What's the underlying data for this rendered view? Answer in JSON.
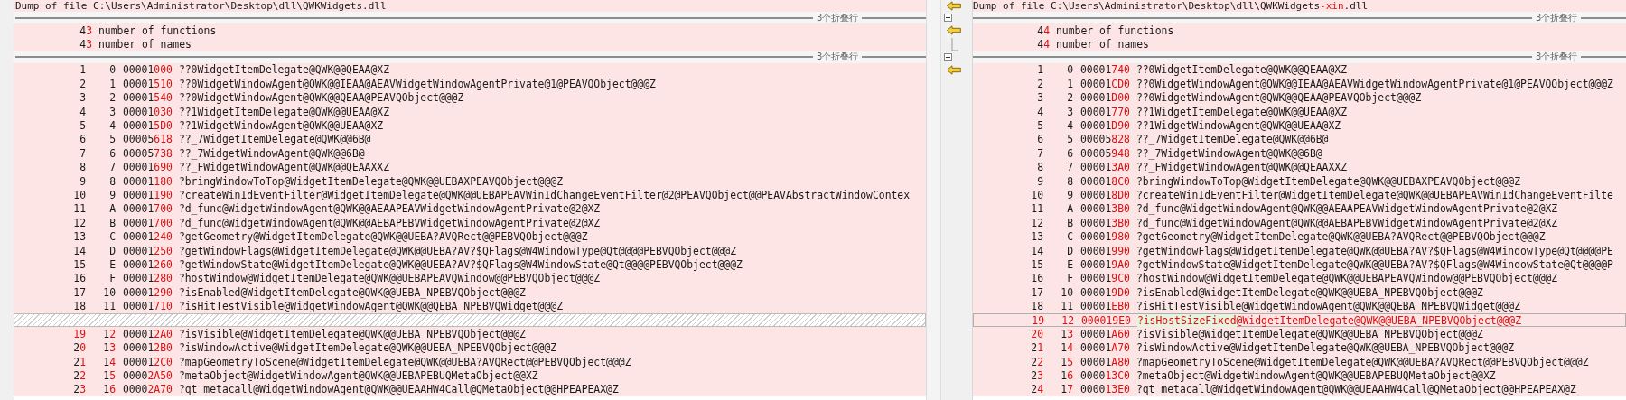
{
  "left_pane": {
    "lines": [
      {
        "kind": "header",
        "text": [
          {
            "text": "Dump of file C:\\Users\\Administrator\\Desktop\\dll\\QWKWidgets.dll"
          }
        ]
      },
      {
        "kind": "fold",
        "label": "3个折叠行"
      },
      {
        "kind": "summary",
        "count": [
          {
            "text": "4"
          },
          {
            "text": "3",
            "changed": true
          }
        ],
        "label": "number of functions"
      },
      {
        "kind": "summary",
        "count": [
          {
            "text": "4"
          },
          {
            "text": "3",
            "changed": true
          }
        ],
        "label": "number of names"
      },
      {
        "kind": "fold",
        "label": "3个折叠行"
      },
      {
        "kind": "export",
        "line": [
          {
            "text": "1"
          }
        ],
        "ordinal": [
          {
            "text": "0"
          }
        ],
        "rva": [
          {
            "text": "00001"
          },
          {
            "text": "000",
            "changed": true
          }
        ],
        "name": [
          {
            "text": "??0WidgetItemDelegate@QWK@@QEAA@XZ"
          }
        ]
      },
      {
        "kind": "export",
        "line": [
          {
            "text": "2"
          }
        ],
        "ordinal": [
          {
            "text": "1"
          }
        ],
        "rva": [
          {
            "text": "00001"
          },
          {
            "text": "510",
            "changed": true
          }
        ],
        "name": [
          {
            "text": "??0WidgetWindowAgent@QWK@@IEAA@AEAVWidgetWindowAgentPrivate@1@PEAVQObject@@@Z"
          }
        ]
      },
      {
        "kind": "export",
        "line": [
          {
            "text": "3"
          }
        ],
        "ordinal": [
          {
            "text": "2"
          }
        ],
        "rva": [
          {
            "text": "00001"
          },
          {
            "text": "540",
            "changed": true
          }
        ],
        "name": [
          {
            "text": "??0WidgetWindowAgent@QWK@@QEAA@PEAVQObject@@@Z"
          }
        ]
      },
      {
        "kind": "export",
        "line": [
          {
            "text": "4"
          }
        ],
        "ordinal": [
          {
            "text": "3"
          }
        ],
        "rva": [
          {
            "text": "00001"
          },
          {
            "text": "030",
            "changed": true
          }
        ],
        "name": [
          {
            "text": "??1WidgetItemDelegate@QWK@@UEAA@XZ"
          }
        ]
      },
      {
        "kind": "export",
        "line": [
          {
            "text": "5"
          }
        ],
        "ordinal": [
          {
            "text": "4"
          }
        ],
        "rva": [
          {
            "text": "00001"
          },
          {
            "text": "5D0",
            "changed": true
          }
        ],
        "name": [
          {
            "text": "??1WidgetWindowAgent@QWK@@UEAA@XZ"
          }
        ]
      },
      {
        "kind": "export",
        "line": [
          {
            "text": "6"
          }
        ],
        "ordinal": [
          {
            "text": "5"
          }
        ],
        "rva": [
          {
            "text": "00005"
          },
          {
            "text": "618",
            "changed": true
          }
        ],
        "name": [
          {
            "text": "??_7WidgetItemDelegate@QWK@@6B@"
          }
        ]
      },
      {
        "kind": "export",
        "line": [
          {
            "text": "7"
          }
        ],
        "ordinal": [
          {
            "text": "6"
          }
        ],
        "rva": [
          {
            "text": "00005"
          },
          {
            "text": "738",
            "changed": true
          }
        ],
        "name": [
          {
            "text": "??_7WidgetWindowAgent@QWK@@6B@"
          }
        ]
      },
      {
        "kind": "export",
        "line": [
          {
            "text": "8"
          }
        ],
        "ordinal": [
          {
            "text": "7"
          }
        ],
        "rva": [
          {
            "text": "00001"
          },
          {
            "text": "690",
            "changed": true
          }
        ],
        "name": [
          {
            "text": "??_FWidgetWindowAgent@QWK@@QEAAXXZ"
          }
        ]
      },
      {
        "kind": "export",
        "line": [
          {
            "text": "9"
          }
        ],
        "ordinal": [
          {
            "text": "8"
          }
        ],
        "rva": [
          {
            "text": "00001"
          },
          {
            "text": "180",
            "changed": true
          }
        ],
        "name": [
          {
            "text": "?bringWindowToTop@WidgetItemDelegate@QWK@@UEBAXPEAVQObject@@@Z"
          }
        ]
      },
      {
        "kind": "export",
        "line": [
          {
            "text": "10"
          }
        ],
        "ordinal": [
          {
            "text": "9"
          }
        ],
        "rva": [
          {
            "text": "00001"
          },
          {
            "text": "190",
            "changed": true
          }
        ],
        "name": [
          {
            "text": "?createWinIdEventFilter@WidgetItemDelegate@QWK@@UEBAPEAVWinIdChangeEventFilter@2@PEAVQObject@@PEAVAbstractWindowContex"
          }
        ]
      },
      {
        "kind": "export",
        "line": [
          {
            "text": "11"
          }
        ],
        "ordinal": [
          {
            "text": "A"
          }
        ],
        "rva": [
          {
            "text": "00001"
          },
          {
            "text": "700",
            "changed": true
          }
        ],
        "name": [
          {
            "text": "?d_func@WidgetWindowAgent@QWK@@AEAAPEAVWidgetWindowAgentPrivate@2@XZ"
          }
        ]
      },
      {
        "kind": "export",
        "line": [
          {
            "text": "12"
          }
        ],
        "ordinal": [
          {
            "text": "B"
          }
        ],
        "rva": [
          {
            "text": "00001"
          },
          {
            "text": "700",
            "changed": true
          }
        ],
        "name": [
          {
            "text": "?d_func@WidgetWindowAgent@QWK@@AEBAPEBVWidgetWindowAgentPrivate@2@XZ"
          }
        ]
      },
      {
        "kind": "export",
        "line": [
          {
            "text": "13"
          }
        ],
        "ordinal": [
          {
            "text": "C"
          }
        ],
        "rva": [
          {
            "text": "00001"
          },
          {
            "text": "240",
            "changed": true
          }
        ],
        "name": [
          {
            "text": "?getGeometry@WidgetItemDelegate@QWK@@UEBA?AVQRect@@PEBVQObject@@@Z"
          }
        ]
      },
      {
        "kind": "export",
        "line": [
          {
            "text": "14"
          }
        ],
        "ordinal": [
          {
            "text": "D"
          }
        ],
        "rva": [
          {
            "text": "00001"
          },
          {
            "text": "250",
            "changed": true
          }
        ],
        "name": [
          {
            "text": "?getWindowFlags@WidgetItemDelegate@QWK@@UEBA?AV?$QFlags@W4WindowType@Qt@@@@PEBVQObject@@@Z"
          }
        ]
      },
      {
        "kind": "export",
        "line": [
          {
            "text": "15"
          }
        ],
        "ordinal": [
          {
            "text": "E"
          }
        ],
        "rva": [
          {
            "text": "00001"
          },
          {
            "text": "260",
            "changed": true
          }
        ],
        "name": [
          {
            "text": "?getWindowState@WidgetItemDelegate@QWK@@UEBA?AV?$QFlags@W4WindowState@Qt@@@@PEBVQObject@@@Z"
          }
        ]
      },
      {
        "kind": "export",
        "line": [
          {
            "text": "16"
          }
        ],
        "ordinal": [
          {
            "text": "F"
          }
        ],
        "rva": [
          {
            "text": "00001"
          },
          {
            "text": "280",
            "changed": true
          }
        ],
        "name": [
          {
            "text": "?hostWindow@WidgetItemDelegate@QWK@@UEBAPEAVQWindow@@PEBVQObject@@@Z"
          }
        ]
      },
      {
        "kind": "export",
        "line": [
          {
            "text": "17"
          }
        ],
        "ordinal": [
          {
            "text": "10"
          }
        ],
        "rva": [
          {
            "text": "00001"
          },
          {
            "text": "290",
            "changed": true
          }
        ],
        "name": [
          {
            "text": "?isEnabled@WidgetItemDelegate@QWK@@UEBA_NPEBVQObject@@@Z"
          }
        ]
      },
      {
        "kind": "export",
        "line": [
          {
            "text": "18"
          }
        ],
        "ordinal": [
          {
            "text": "11"
          }
        ],
        "rva": [
          {
            "text": "00001"
          },
          {
            "text": "710",
            "changed": true
          }
        ],
        "name": [
          {
            "text": "?isHitTestVisible@WidgetWindowAgent@QWK@@QEBA_NPEBVQWidget@@@Z"
          }
        ]
      },
      {
        "kind": "gap"
      },
      {
        "kind": "export",
        "line": [
          {
            "text": "19",
            "changed": true
          }
        ],
        "ordinal": [
          {
            "text": "1"
          },
          {
            "text": "2",
            "changed": true
          }
        ],
        "rva": [
          {
            "text": "00001"
          },
          {
            "text": "2A0",
            "changed": true
          }
        ],
        "name": [
          {
            "text": "?isVisible@WidgetItemDelegate@QWK@@UEBA_NPEBVQObject@@@Z"
          }
        ]
      },
      {
        "kind": "export",
        "line": [
          {
            "text": "2"
          },
          {
            "text": "0",
            "changed": true
          }
        ],
        "ordinal": [
          {
            "text": "1"
          },
          {
            "text": "3",
            "changed": true
          }
        ],
        "rva": [
          {
            "text": "00001"
          },
          {
            "text": "2B0",
            "changed": true
          }
        ],
        "name": [
          {
            "text": "?isWindowActive@WidgetItemDelegate@QWK@@UEBA_NPEBVQObject@@@Z"
          }
        ]
      },
      {
        "kind": "export",
        "line": [
          {
            "text": "2"
          },
          {
            "text": "1",
            "changed": true
          }
        ],
        "ordinal": [
          {
            "text": "1"
          },
          {
            "text": "4",
            "changed": true
          }
        ],
        "rva": [
          {
            "text": "00001"
          },
          {
            "text": "2C0",
            "changed": true
          }
        ],
        "name": [
          {
            "text": "?mapGeometryToScene@WidgetItemDelegate@QWK@@UEBA?AVQRect@@PEBVQObject@@@Z"
          }
        ]
      },
      {
        "kind": "export",
        "line": [
          {
            "text": "2"
          },
          {
            "text": "2",
            "changed": true
          }
        ],
        "ordinal": [
          {
            "text": "1"
          },
          {
            "text": "5",
            "changed": true
          }
        ],
        "rva": [
          {
            "text": "0000"
          },
          {
            "text": "2A50",
            "changed": true
          }
        ],
        "name": [
          {
            "text": "?metaObject@WidgetWindowAgent@QWK@@UEBAPEBUQMetaObject@@XZ"
          }
        ]
      },
      {
        "kind": "export",
        "line": [
          {
            "text": "2"
          },
          {
            "text": "3",
            "changed": true
          }
        ],
        "ordinal": [
          {
            "text": "1"
          },
          {
            "text": "6",
            "changed": true
          }
        ],
        "rva": [
          {
            "text": "0000"
          },
          {
            "text": "2A70",
            "changed": true
          }
        ],
        "name": [
          {
            "text": "?qt_metacall@WidgetWindowAgent@QWK@@UEAAHW4Call@QMetaObject@@HPEAPEAX@Z"
          }
        ]
      }
    ]
  },
  "right_pane": {
    "lines": [
      {
        "kind": "header",
        "arrow": true,
        "text": [
          {
            "text": "Dump of file C:\\Users\\Administrator\\Desktop\\dll\\QWKWidgets"
          },
          {
            "text": "-xin",
            "changed": true
          },
          {
            "text": ".dll"
          }
        ]
      },
      {
        "kind": "fold",
        "label": "3个折叠行",
        "expandable": true
      },
      {
        "kind": "summary",
        "arrow": true,
        "count": [
          {
            "text": "4"
          },
          {
            "text": "4",
            "changed": true
          }
        ],
        "label": "number of functions"
      },
      {
        "kind": "summary",
        "tree_branch": true,
        "count": [
          {
            "text": "4"
          },
          {
            "text": "4",
            "changed": true
          }
        ],
        "label": "number of names"
      },
      {
        "kind": "fold",
        "label": "3个折叠行",
        "expandable": true
      },
      {
        "kind": "export",
        "arrow": true,
        "inserted": false,
        "line": [
          {
            "text": "1"
          }
        ],
        "ordinal": [
          {
            "text": "0"
          }
        ],
        "rva": [
          {
            "text": "00001"
          },
          {
            "text": "740",
            "changed": true
          }
        ],
        "name": [
          {
            "text": "??0WidgetItemDelegate@QWK@@QEAA@XZ"
          }
        ]
      },
      {
        "kind": "export",
        "inserted": false,
        "line": [
          {
            "text": "2"
          }
        ],
        "ordinal": [
          {
            "text": "1"
          }
        ],
        "rva": [
          {
            "text": "00001"
          },
          {
            "text": "CD0",
            "changed": true
          }
        ],
        "name": [
          {
            "text": "??0WidgetWindowAgent@QWK@@IEAA@AEAVWidgetWindowAgentPrivate@1@PEAVQObject@@@Z"
          }
        ]
      },
      {
        "kind": "export",
        "inserted": false,
        "line": [
          {
            "text": "3"
          }
        ],
        "ordinal": [
          {
            "text": "2"
          }
        ],
        "rva": [
          {
            "text": "00001"
          },
          {
            "text": "D00",
            "changed": true
          }
        ],
        "name": [
          {
            "text": "??0WidgetWindowAgent@QWK@@QEAA@PEAVQObject@@@Z"
          }
        ]
      },
      {
        "kind": "export",
        "inserted": false,
        "line": [
          {
            "text": "4"
          }
        ],
        "ordinal": [
          {
            "text": "3"
          }
        ],
        "rva": [
          {
            "text": "00001"
          },
          {
            "text": "770",
            "changed": true
          }
        ],
        "name": [
          {
            "text": "??1WidgetItemDelegate@QWK@@UEAA@XZ"
          }
        ]
      },
      {
        "kind": "export",
        "inserted": false,
        "line": [
          {
            "text": "5"
          }
        ],
        "ordinal": [
          {
            "text": "4"
          }
        ],
        "rva": [
          {
            "text": "00001"
          },
          {
            "text": "D90",
            "changed": true
          }
        ],
        "name": [
          {
            "text": "??1WidgetWindowAgent@QWK@@UEAA@XZ"
          }
        ]
      },
      {
        "kind": "export",
        "inserted": false,
        "line": [
          {
            "text": "6"
          }
        ],
        "ordinal": [
          {
            "text": "5"
          }
        ],
        "rva": [
          {
            "text": "00005"
          },
          {
            "text": "828",
            "changed": true
          }
        ],
        "name": [
          {
            "text": "??_7WidgetItemDelegate@QWK@@6B@"
          }
        ]
      },
      {
        "kind": "export",
        "inserted": false,
        "line": [
          {
            "text": "7"
          }
        ],
        "ordinal": [
          {
            "text": "6"
          }
        ],
        "rva": [
          {
            "text": "00005"
          },
          {
            "text": "948",
            "changed": true
          }
        ],
        "name": [
          {
            "text": "??_7WidgetWindowAgent@QWK@@6B@"
          }
        ]
      },
      {
        "kind": "export",
        "inserted": false,
        "line": [
          {
            "text": "8"
          }
        ],
        "ordinal": [
          {
            "text": "7"
          }
        ],
        "rva": [
          {
            "text": "00001"
          },
          {
            "text": "3A0",
            "changed": true
          }
        ],
        "name": [
          {
            "text": "??_FWidgetWindowAgent@QWK@@QEAAXXZ"
          }
        ]
      },
      {
        "kind": "export",
        "inserted": false,
        "line": [
          {
            "text": "9"
          }
        ],
        "ordinal": [
          {
            "text": "8"
          }
        ],
        "rva": [
          {
            "text": "00001"
          },
          {
            "text": "8C0",
            "changed": true
          }
        ],
        "name": [
          {
            "text": "?bringWindowToTop@WidgetItemDelegate@QWK@@UEBAXPEAVQObject@@@Z"
          }
        ]
      },
      {
        "kind": "export",
        "inserted": false,
        "line": [
          {
            "text": "10"
          }
        ],
        "ordinal": [
          {
            "text": "9"
          }
        ],
        "rva": [
          {
            "text": "00001"
          },
          {
            "text": "8D0",
            "changed": true
          }
        ],
        "name": [
          {
            "text": "?createWinIdEventFilter@WidgetItemDelegate@QWK@@UEBAPEAVWinIdChangeEventFilte"
          }
        ]
      },
      {
        "kind": "export",
        "inserted": false,
        "line": [
          {
            "text": "11"
          }
        ],
        "ordinal": [
          {
            "text": "A"
          }
        ],
        "rva": [
          {
            "text": "00001"
          },
          {
            "text": "3B0",
            "changed": true
          }
        ],
        "name": [
          {
            "text": "?d_func@WidgetWindowAgent@QWK@@AEAAPEAVWidgetWindowAgentPrivate@2@XZ"
          }
        ]
      },
      {
        "kind": "export",
        "inserted": false,
        "line": [
          {
            "text": "12"
          }
        ],
        "ordinal": [
          {
            "text": "B"
          }
        ],
        "rva": [
          {
            "text": "00001"
          },
          {
            "text": "3B0",
            "changed": true
          }
        ],
        "name": [
          {
            "text": "?d_func@WidgetWindowAgent@QWK@@AEBAPEBVWidgetWindowAgentPrivate@2@XZ"
          }
        ]
      },
      {
        "kind": "export",
        "inserted": false,
        "line": [
          {
            "text": "13"
          }
        ],
        "ordinal": [
          {
            "text": "C"
          }
        ],
        "rva": [
          {
            "text": "00001"
          },
          {
            "text": "980",
            "changed": true
          }
        ],
        "name": [
          {
            "text": "?getGeometry@WidgetItemDelegate@QWK@@UEBA?AVQRect@@PEBVQObject@@@Z"
          }
        ]
      },
      {
        "kind": "export",
        "inserted": false,
        "line": [
          {
            "text": "14"
          }
        ],
        "ordinal": [
          {
            "text": "D"
          }
        ],
        "rva": [
          {
            "text": "00001"
          },
          {
            "text": "990",
            "changed": true
          }
        ],
        "name": [
          {
            "text": "?getWindowFlags@WidgetItemDelegate@QWK@@UEBA?AV?$QFlags@W4WindowType@Qt@@@@PE"
          }
        ]
      },
      {
        "kind": "export",
        "inserted": false,
        "line": [
          {
            "text": "15"
          }
        ],
        "ordinal": [
          {
            "text": "E"
          }
        ],
        "rva": [
          {
            "text": "00001"
          },
          {
            "text": "9A0",
            "changed": true
          }
        ],
        "name": [
          {
            "text": "?getWindowState@WidgetItemDelegate@QWK@@UEBA?AV?$QFlags@W4WindowState@Qt@@@@P"
          }
        ]
      },
      {
        "kind": "export",
        "inserted": false,
        "line": [
          {
            "text": "16"
          }
        ],
        "ordinal": [
          {
            "text": "F"
          }
        ],
        "rva": [
          {
            "text": "00001"
          },
          {
            "text": "9C0",
            "changed": true
          }
        ],
        "name": [
          {
            "text": "?hostWindow@WidgetItemDelegate@QWK@@UEBAPEAVQWindow@@PEBVQObject@@@Z"
          }
        ]
      },
      {
        "kind": "export",
        "inserted": false,
        "line": [
          {
            "text": "17"
          }
        ],
        "ordinal": [
          {
            "text": "10"
          }
        ],
        "rva": [
          {
            "text": "00001"
          },
          {
            "text": "9D0",
            "changed": true
          }
        ],
        "name": [
          {
            "text": "?isEnabled@WidgetItemDelegate@QWK@@UEBA_NPEBVQObject@@@Z"
          }
        ]
      },
      {
        "kind": "export",
        "inserted": false,
        "line": [
          {
            "text": "18"
          }
        ],
        "ordinal": [
          {
            "text": "11"
          }
        ],
        "rva": [
          {
            "text": "00001"
          },
          {
            "text": "EB0",
            "changed": true
          }
        ],
        "name": [
          {
            "text": "?isHitTestVisible@WidgetWindowAgent@QWK@@QEBA_NPEBVQWidget@@@Z"
          }
        ]
      },
      {
        "kind": "export",
        "inserted": true,
        "line": [
          {
            "text": "19"
          }
        ],
        "ordinal": [
          {
            "text": "12"
          }
        ],
        "rva": [
          {
            "text": "000019E0"
          }
        ],
        "name": [
          {
            "text": "?isHostSizeFixed",
            "highlight": true
          },
          {
            "text": "@WidgetItemDelegate@QWK@@UEBA_NPEBVQObject@@@Z"
          }
        ]
      },
      {
        "kind": "export",
        "inserted": false,
        "line": [
          {
            "text": "20",
            "changed": true
          }
        ],
        "ordinal": [
          {
            "text": "1"
          },
          {
            "text": "3",
            "changed": true
          }
        ],
        "rva": [
          {
            "text": "00001"
          },
          {
            "text": "A60",
            "changed": true
          }
        ],
        "name": [
          {
            "text": "?isVisible@WidgetItemDelegate@QWK@@UEBA_NPEBVQObject@@@Z"
          }
        ]
      },
      {
        "kind": "export",
        "inserted": false,
        "line": [
          {
            "text": "2"
          },
          {
            "text": "1",
            "changed": true
          }
        ],
        "ordinal": [
          {
            "text": "1"
          },
          {
            "text": "4",
            "changed": true
          }
        ],
        "rva": [
          {
            "text": "00001"
          },
          {
            "text": "A70",
            "changed": true
          }
        ],
        "name": [
          {
            "text": "?isWindowActive@WidgetItemDelegate@QWK@@UEBA_NPEBVQObject@@@Z"
          }
        ]
      },
      {
        "kind": "export",
        "inserted": false,
        "line": [
          {
            "text": "2"
          },
          {
            "text": "2",
            "changed": true
          }
        ],
        "ordinal": [
          {
            "text": "1"
          },
          {
            "text": "5",
            "changed": true
          }
        ],
        "rva": [
          {
            "text": "00001"
          },
          {
            "text": "A80",
            "changed": true
          }
        ],
        "name": [
          {
            "text": "?mapGeometryToScene@WidgetItemDelegate@QWK@@UEBA?AVQRect@@PEBVQObject@@@Z"
          }
        ]
      },
      {
        "kind": "export",
        "inserted": false,
        "line": [
          {
            "text": "2"
          },
          {
            "text": "3",
            "changed": true
          }
        ],
        "ordinal": [
          {
            "text": "1"
          },
          {
            "text": "6",
            "changed": true
          }
        ],
        "rva": [
          {
            "text": "0000"
          },
          {
            "text": "13C0",
            "changed": true
          }
        ],
        "name": [
          {
            "text": "?metaObject@WidgetWindowAgent@QWK@@UEBAPEBUQMetaObject@@XZ"
          }
        ]
      },
      {
        "kind": "export",
        "inserted": false,
        "line": [
          {
            "text": "2"
          },
          {
            "text": "4",
            "changed": true
          }
        ],
        "ordinal": [
          {
            "text": "1"
          },
          {
            "text": "7",
            "changed": true
          }
        ],
        "rva": [
          {
            "text": "0000"
          },
          {
            "text": "13E0",
            "changed": true
          }
        ],
        "name": [
          {
            "text": "?qt_metacall@WidgetWindowAgent@QWK@@UEAAHW4Call@QMetaObject@@HPEAPEAX@Z"
          }
        ]
      }
    ]
  }
}
